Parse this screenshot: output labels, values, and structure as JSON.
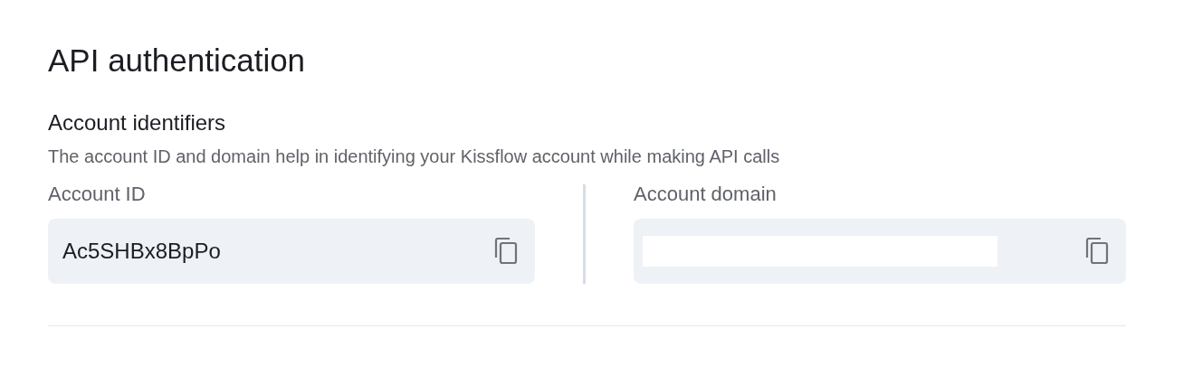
{
  "title": "API authentication",
  "section": {
    "heading": "Account identifiers",
    "description": "The account ID and domain help in identifying your Kissflow account while making API calls"
  },
  "fields": [
    {
      "label": "Account ID",
      "value": "Ac5SHBx8BpPo",
      "redacted": false
    },
    {
      "label": "Account domain",
      "redacted": true
    }
  ]
}
